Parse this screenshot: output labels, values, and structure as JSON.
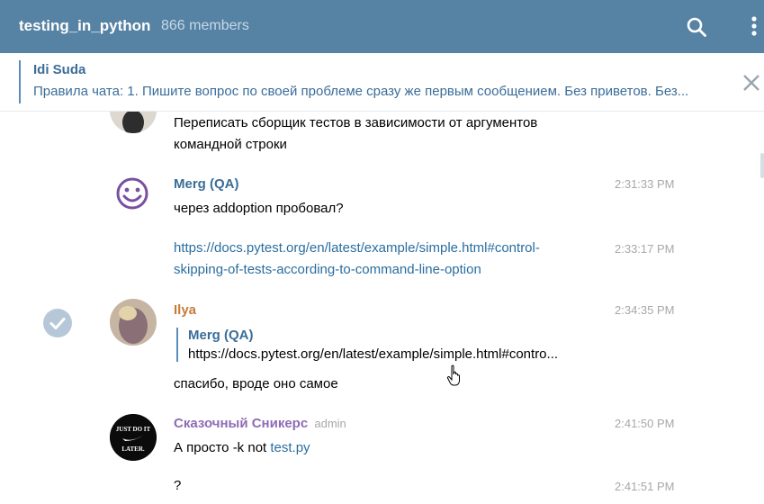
{
  "header": {
    "title": "testing_in_python",
    "members": "866 members",
    "search_icon": "search-icon",
    "more_icon": "more-vert-icon",
    "bg_color": "#5682a3"
  },
  "pinned": {
    "author": "Idi Suda",
    "text": "Правила чата: 1. Пишите вопрос по своей проблеме сразу же первым сообщением. Без приветов. Без...",
    "close_icon": "close-icon"
  },
  "messages": {
    "m0": {
      "text_line1": "Переписать сборщик тестов в зависимости от аргументов",
      "text_line2": "командной строки"
    },
    "m1": {
      "name": "Merg (QA)",
      "time": "2:31:33 PM",
      "text": "через addoption пробовал?"
    },
    "m2": {
      "time": "2:33:17 PM",
      "link_line1": "https://docs.pytest.org/en/latest/example/simple.html#control-",
      "link_line2": "skipping-of-tests-according-to-command-line-option"
    },
    "m3": {
      "name": "Ilya",
      "time": "2:34:35 PM",
      "quote_name": "Merg (QA)",
      "quote_text": "https://docs.pytest.org/en/latest/example/simple.html#contro...",
      "text": "спасибо, вроде оно самое"
    },
    "m4": {
      "name": "Сказочный Сникерс",
      "badge": "admin",
      "time": "2:41:50 PM",
      "text_prefix": "А просто -k not ",
      "text_link": "test.py",
      "avatar_text_top": "JUST DO IT",
      "avatar_text_bottom": "LATER."
    },
    "m5": {
      "time": "2:41:51 PM",
      "text": "?"
    }
  },
  "colors": {
    "merg_name": "#3a6d99",
    "ilya_name": "#c77a3a",
    "snickers_name": "#8e6bb5",
    "link": "#2a6e9f"
  }
}
